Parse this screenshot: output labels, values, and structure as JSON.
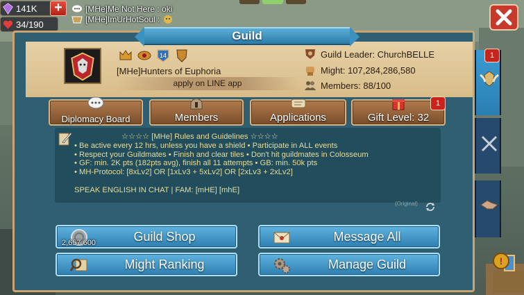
{
  "resources": {
    "gems": "141K",
    "health": "34/190"
  },
  "chat": [
    {
      "sender": "[MHe]Me Not Here",
      "message": "oki",
      "text": "[MHe]Me Not Here : oki"
    },
    {
      "sender": "[MHe]ImUrHotSoul",
      "message": "",
      "text": "[MHe]ImUrHotSoul :"
    }
  ],
  "window": {
    "title": "Guild"
  },
  "guild": {
    "name": "[MHe]Hunters of Euphoria",
    "message": "apply on LINE app",
    "tag_level": "14",
    "leader": "Guild Leader: ChurchBELLE",
    "might": "Might: 107,284,286,580",
    "members": "Members: 88/100"
  },
  "tabs": {
    "diplomacy": "Diplomacy Board",
    "members": "Members",
    "applications": "Applications",
    "gift": "Gift Level: 32",
    "gift_badge": "1"
  },
  "side_badge": "1",
  "rules": {
    "title": "☆☆☆☆ [MHe] Rules and Guidelines ☆☆☆☆",
    "lines": [
      "• Be active every 12 hrs, unless you have a shield • Participate in ALL events",
      "• Respect your Guildmates • Finish and clear tiles • Don't hit guildmates in Colosseum",
      "• GF: min. 2K pts (182pts avg), finish all 11 attempts • GB: min. 50k pts",
      "• MH-Protocol: [8xLv2] OR [1xLv3 + 5xLv2] OR [2xLv3 + 2xLv2]",
      "",
      "SPEAK ENGLISH IN CHAT | FAM: [mHE] [mhE]"
    ],
    "original_label": "(Original)"
  },
  "buttons": {
    "shop": "Guild Shop",
    "shop_count": "2,657,600",
    "message_all": "Message All",
    "might_ranking": "Might Ranking",
    "manage": "Manage Guild"
  },
  "colors": {
    "panel": "#2f5f70",
    "header": "#e6d0a5",
    "tab_brown": "#8f5e34",
    "button_blue": "#3f93c6",
    "rules_text": "#e8dc9a",
    "badge_red": "#c9241b"
  }
}
